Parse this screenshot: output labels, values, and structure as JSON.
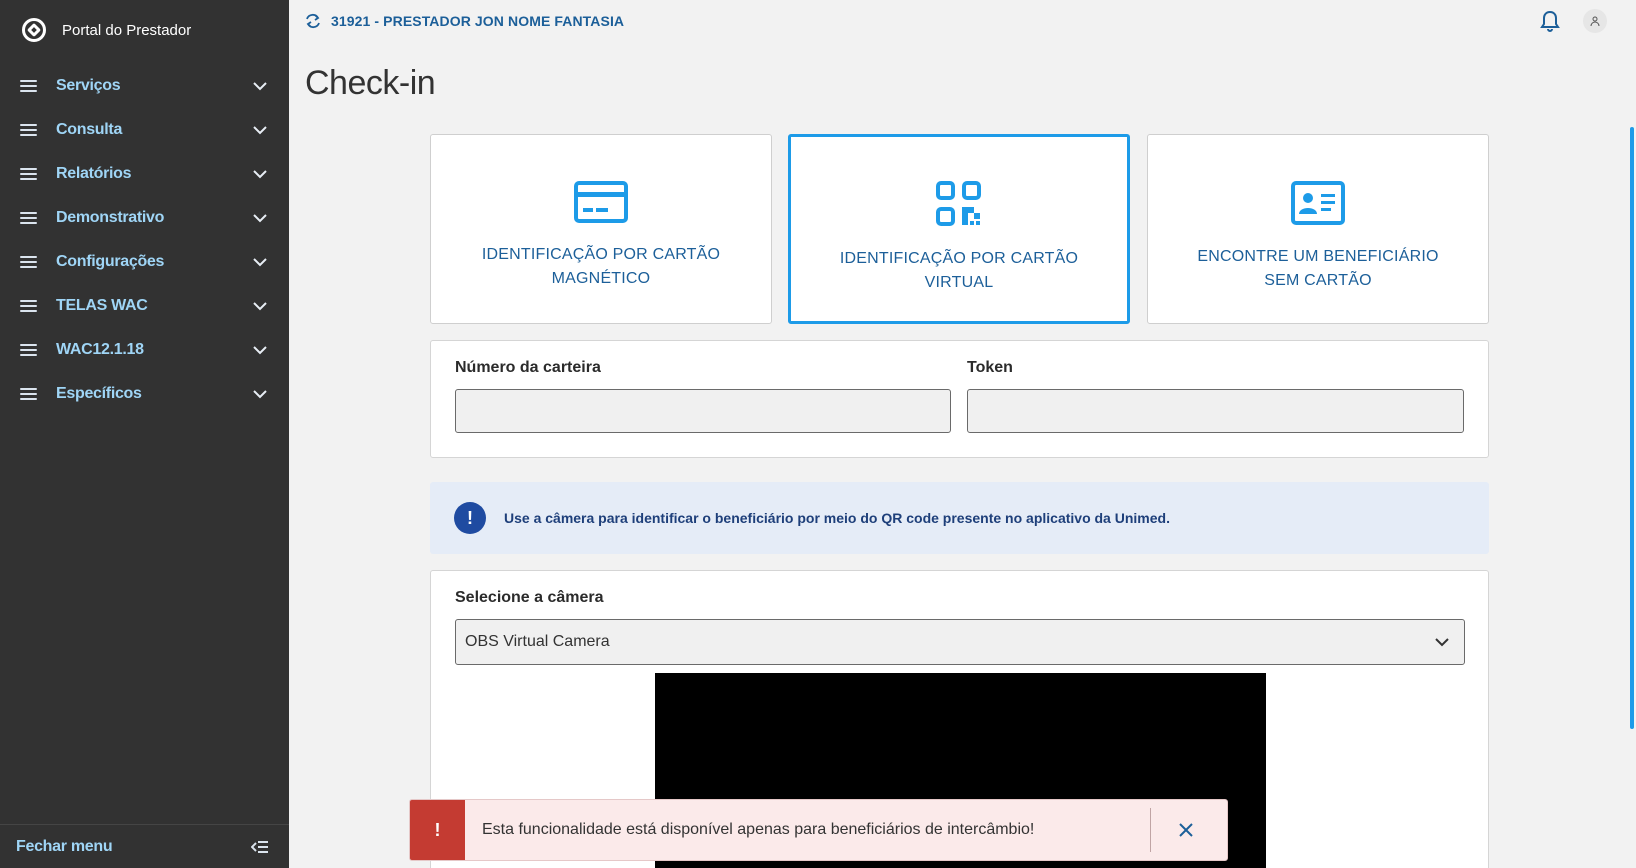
{
  "app": {
    "name": "Portal do Prestador"
  },
  "sidebar": {
    "items": [
      {
        "label": "Serviços"
      },
      {
        "label": "Consulta"
      },
      {
        "label": "Relatórios"
      },
      {
        "label": "Demonstrativo"
      },
      {
        "label": "Configurações"
      },
      {
        "label": "TELAS WAC"
      },
      {
        "label": "WAC12.1.18"
      },
      {
        "label": "Específicos"
      }
    ],
    "footer_label": "Fechar menu"
  },
  "topbar": {
    "provider": "31921 - PRESTADOR JON NOME FANTASIA"
  },
  "page": {
    "title": "Check-in"
  },
  "cards": [
    {
      "label": "IDENTIFICAÇÃO POR CARTÃO MAGNÉTICO",
      "icon": "credit-card-icon"
    },
    {
      "label": "IDENTIFICAÇÃO POR CARTÃO VIRTUAL",
      "icon": "qr-code-icon",
      "selected": true
    },
    {
      "label": "ENCONTRE UM BENEFICIÁRIO SEM CARTÃO",
      "icon": "id-card-icon"
    }
  ],
  "form": {
    "card_number_label": "Número da carteira",
    "card_number_value": "",
    "token_label": "Token",
    "token_value": ""
  },
  "alert": {
    "icon": "!",
    "text": "Use a câmera para identificar o beneficiário por meio do QR code presente no aplicativo da Unimed."
  },
  "camera": {
    "label": "Selecione a câmera",
    "selected": "OBS Virtual Camera"
  },
  "toast": {
    "icon": "!",
    "text": "Esta funcionalidade está disponível apenas para beneficiários de intercâmbio!"
  },
  "colors": {
    "sidebar_bg": "#323232",
    "sidebar_text": "#9fd5f6",
    "accent": "#1d9be8",
    "primary_text": "#1c5f99",
    "alert_bg": "#e5ecf7",
    "error": "#c43b32"
  }
}
